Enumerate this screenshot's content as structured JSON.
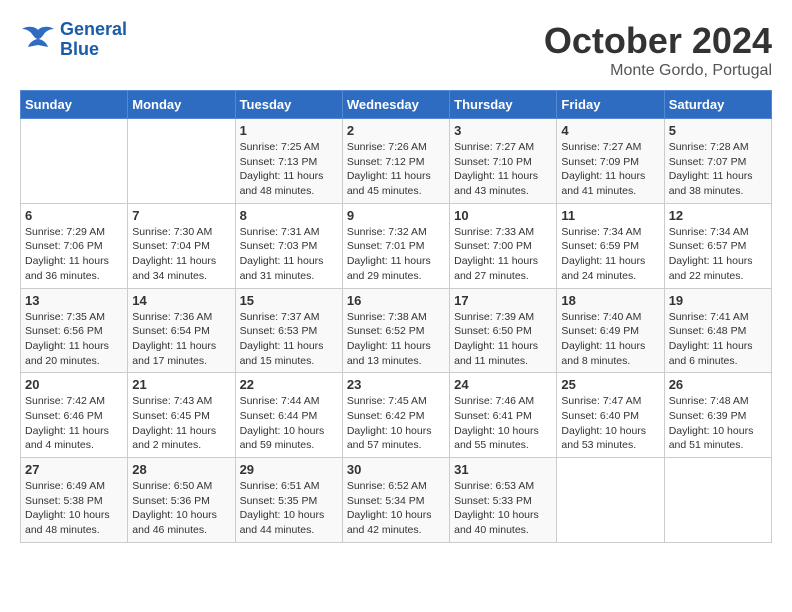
{
  "header": {
    "logo_line1": "General",
    "logo_line2": "Blue",
    "month": "October 2024",
    "location": "Monte Gordo, Portugal"
  },
  "weekdays": [
    "Sunday",
    "Monday",
    "Tuesday",
    "Wednesday",
    "Thursday",
    "Friday",
    "Saturday"
  ],
  "weeks": [
    [
      {
        "day": "",
        "info": ""
      },
      {
        "day": "",
        "info": ""
      },
      {
        "day": "1",
        "info": "Sunrise: 7:25 AM\nSunset: 7:13 PM\nDaylight: 11 hours and 48 minutes."
      },
      {
        "day": "2",
        "info": "Sunrise: 7:26 AM\nSunset: 7:12 PM\nDaylight: 11 hours and 45 minutes."
      },
      {
        "day": "3",
        "info": "Sunrise: 7:27 AM\nSunset: 7:10 PM\nDaylight: 11 hours and 43 minutes."
      },
      {
        "day": "4",
        "info": "Sunrise: 7:27 AM\nSunset: 7:09 PM\nDaylight: 11 hours and 41 minutes."
      },
      {
        "day": "5",
        "info": "Sunrise: 7:28 AM\nSunset: 7:07 PM\nDaylight: 11 hours and 38 minutes."
      }
    ],
    [
      {
        "day": "6",
        "info": "Sunrise: 7:29 AM\nSunset: 7:06 PM\nDaylight: 11 hours and 36 minutes."
      },
      {
        "day": "7",
        "info": "Sunrise: 7:30 AM\nSunset: 7:04 PM\nDaylight: 11 hours and 34 minutes."
      },
      {
        "day": "8",
        "info": "Sunrise: 7:31 AM\nSunset: 7:03 PM\nDaylight: 11 hours and 31 minutes."
      },
      {
        "day": "9",
        "info": "Sunrise: 7:32 AM\nSunset: 7:01 PM\nDaylight: 11 hours and 29 minutes."
      },
      {
        "day": "10",
        "info": "Sunrise: 7:33 AM\nSunset: 7:00 PM\nDaylight: 11 hours and 27 minutes."
      },
      {
        "day": "11",
        "info": "Sunrise: 7:34 AM\nSunset: 6:59 PM\nDaylight: 11 hours and 24 minutes."
      },
      {
        "day": "12",
        "info": "Sunrise: 7:34 AM\nSunset: 6:57 PM\nDaylight: 11 hours and 22 minutes."
      }
    ],
    [
      {
        "day": "13",
        "info": "Sunrise: 7:35 AM\nSunset: 6:56 PM\nDaylight: 11 hours and 20 minutes."
      },
      {
        "day": "14",
        "info": "Sunrise: 7:36 AM\nSunset: 6:54 PM\nDaylight: 11 hours and 17 minutes."
      },
      {
        "day": "15",
        "info": "Sunrise: 7:37 AM\nSunset: 6:53 PM\nDaylight: 11 hours and 15 minutes."
      },
      {
        "day": "16",
        "info": "Sunrise: 7:38 AM\nSunset: 6:52 PM\nDaylight: 11 hours and 13 minutes."
      },
      {
        "day": "17",
        "info": "Sunrise: 7:39 AM\nSunset: 6:50 PM\nDaylight: 11 hours and 11 minutes."
      },
      {
        "day": "18",
        "info": "Sunrise: 7:40 AM\nSunset: 6:49 PM\nDaylight: 11 hours and 8 minutes."
      },
      {
        "day": "19",
        "info": "Sunrise: 7:41 AM\nSunset: 6:48 PM\nDaylight: 11 hours and 6 minutes."
      }
    ],
    [
      {
        "day": "20",
        "info": "Sunrise: 7:42 AM\nSunset: 6:46 PM\nDaylight: 11 hours and 4 minutes."
      },
      {
        "day": "21",
        "info": "Sunrise: 7:43 AM\nSunset: 6:45 PM\nDaylight: 11 hours and 2 minutes."
      },
      {
        "day": "22",
        "info": "Sunrise: 7:44 AM\nSunset: 6:44 PM\nDaylight: 10 hours and 59 minutes."
      },
      {
        "day": "23",
        "info": "Sunrise: 7:45 AM\nSunset: 6:42 PM\nDaylight: 10 hours and 57 minutes."
      },
      {
        "day": "24",
        "info": "Sunrise: 7:46 AM\nSunset: 6:41 PM\nDaylight: 10 hours and 55 minutes."
      },
      {
        "day": "25",
        "info": "Sunrise: 7:47 AM\nSunset: 6:40 PM\nDaylight: 10 hours and 53 minutes."
      },
      {
        "day": "26",
        "info": "Sunrise: 7:48 AM\nSunset: 6:39 PM\nDaylight: 10 hours and 51 minutes."
      }
    ],
    [
      {
        "day": "27",
        "info": "Sunrise: 6:49 AM\nSunset: 5:38 PM\nDaylight: 10 hours and 48 minutes."
      },
      {
        "day": "28",
        "info": "Sunrise: 6:50 AM\nSunset: 5:36 PM\nDaylight: 10 hours and 46 minutes."
      },
      {
        "day": "29",
        "info": "Sunrise: 6:51 AM\nSunset: 5:35 PM\nDaylight: 10 hours and 44 minutes."
      },
      {
        "day": "30",
        "info": "Sunrise: 6:52 AM\nSunset: 5:34 PM\nDaylight: 10 hours and 42 minutes."
      },
      {
        "day": "31",
        "info": "Sunrise: 6:53 AM\nSunset: 5:33 PM\nDaylight: 10 hours and 40 minutes."
      },
      {
        "day": "",
        "info": ""
      },
      {
        "day": "",
        "info": ""
      }
    ]
  ]
}
